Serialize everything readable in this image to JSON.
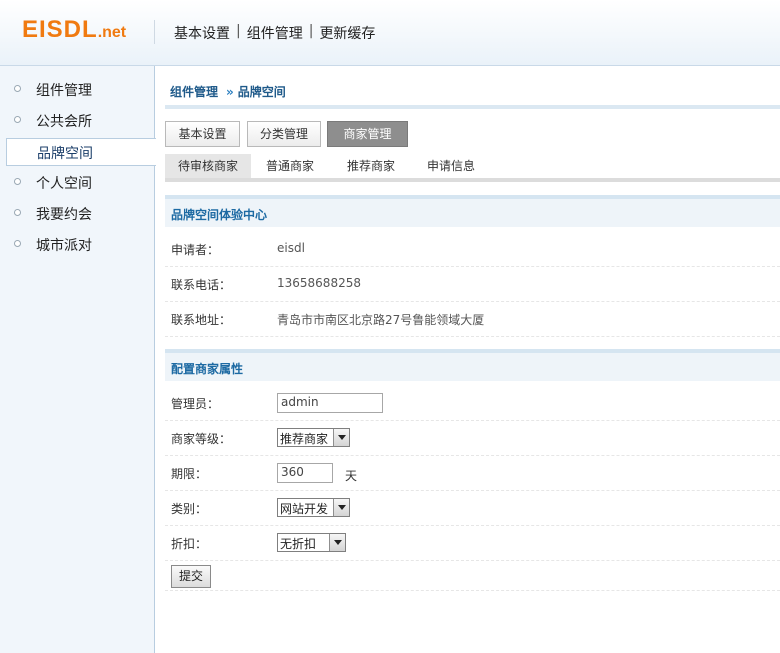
{
  "brand": {
    "logo_main": "EISDL",
    "logo_suffix": ".net"
  },
  "topnav": [
    "基本设置",
    "组件管理",
    "更新缓存"
  ],
  "sidebar": {
    "items": [
      {
        "label": "组件管理"
      },
      {
        "label": "公共会所"
      },
      {
        "label": "品牌空间",
        "active": true
      },
      {
        "label": "个人空间"
      },
      {
        "label": "我要约会"
      },
      {
        "label": "城市派对"
      }
    ]
  },
  "breadcrumb": {
    "parent": "组件管理",
    "separator": "»",
    "current": "品牌空间"
  },
  "tabs": [
    {
      "label": "基本设置"
    },
    {
      "label": "分类管理"
    },
    {
      "label": "商家管理",
      "active": true
    }
  ],
  "subtabs": [
    {
      "label": "待审核商家",
      "active": true
    },
    {
      "label": "普通商家"
    },
    {
      "label": "推荐商家"
    },
    {
      "label": "申请信息"
    }
  ],
  "info_section": {
    "title": "品牌空间体验中心",
    "rows": [
      {
        "label": "申请者：",
        "value": "eisdl"
      },
      {
        "label": "联系电话：",
        "value": "13658688258"
      },
      {
        "label": "联系地址：",
        "value": "青岛市市南区北京路27号鲁能领域大厦"
      }
    ]
  },
  "config_section": {
    "title": "配置商家属性",
    "admin": {
      "label": "管理员：",
      "value": "admin"
    },
    "level": {
      "label": "商家等级：",
      "value": "推荐商家"
    },
    "period": {
      "label": "期限：",
      "value": "360",
      "unit": "天"
    },
    "category": {
      "label": "类别：",
      "value": "网站开发"
    },
    "discount": {
      "label": "折扣：",
      "value": "无折扣"
    },
    "submit_label": "提交"
  },
  "colors": {
    "logo": "#f07a10",
    "accent": "#1d6aa3",
    "sidebar_bg": "#f1f6fb"
  }
}
